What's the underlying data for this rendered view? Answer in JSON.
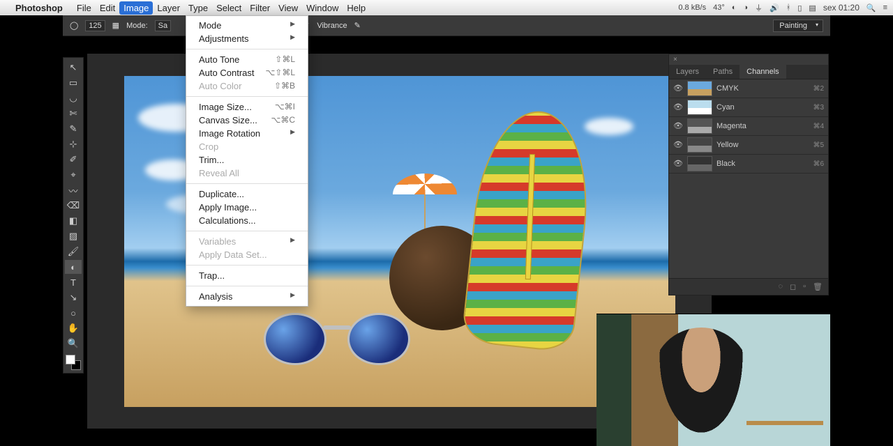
{
  "menubar": {
    "app": "Photoshop",
    "items": [
      "File",
      "Edit",
      "Image",
      "Layer",
      "Type",
      "Select",
      "Filter",
      "View",
      "Window",
      "Help"
    ],
    "active_index": 2,
    "status_net": "0.8 kB/s",
    "status_temp": "43°",
    "clock": "sex 01:20"
  },
  "options_bar": {
    "brush_size": "125",
    "mode_label": "Mode:",
    "mode_value": "Sa",
    "vibrance_label": "Vibrance",
    "workspace": "Painting"
  },
  "dropdown": {
    "groups": [
      [
        {
          "label": "Mode",
          "submenu": true
        },
        {
          "label": "Adjustments",
          "submenu": true
        }
      ],
      [
        {
          "label": "Auto Tone",
          "shortcut": "⇧⌘L"
        },
        {
          "label": "Auto Contrast",
          "shortcut": "⌥⇧⌘L"
        },
        {
          "label": "Auto Color",
          "shortcut": "⇧⌘B",
          "disabled": true
        }
      ],
      [
        {
          "label": "Image Size...",
          "shortcut": "⌥⌘I"
        },
        {
          "label": "Canvas Size...",
          "shortcut": "⌥⌘C"
        },
        {
          "label": "Image Rotation",
          "submenu": true
        },
        {
          "label": "Crop",
          "disabled": true
        },
        {
          "label": "Trim..."
        },
        {
          "label": "Reveal All",
          "disabled": true
        }
      ],
      [
        {
          "label": "Duplicate..."
        },
        {
          "label": "Apply Image..."
        },
        {
          "label": "Calculations..."
        }
      ],
      [
        {
          "label": "Variables",
          "submenu": true,
          "disabled": true
        },
        {
          "label": "Apply Data Set...",
          "disabled": true
        }
      ],
      [
        {
          "label": "Trap..."
        }
      ],
      [
        {
          "label": "Analysis",
          "submenu": true
        }
      ]
    ]
  },
  "tools": [
    "↖",
    "▭",
    "◡",
    "✄",
    "✎",
    "⊹",
    "✐",
    "⌖",
    "〰",
    "⌫",
    "◧",
    "▨",
    "🖌",
    "◐",
    "T",
    "↘",
    "○",
    "✋",
    "🔍"
  ],
  "channels_panel": {
    "tabs": [
      "Layers",
      "Paths",
      "Channels"
    ],
    "active_tab": 2,
    "rows": [
      {
        "name": "CMYK",
        "shortcut": "⌘2",
        "cls": "cmyk"
      },
      {
        "name": "Cyan",
        "shortcut": "⌘3",
        "cls": "c"
      },
      {
        "name": "Magenta",
        "shortcut": "⌘4",
        "cls": "m"
      },
      {
        "name": "Yellow",
        "shortcut": "⌘5",
        "cls": "y"
      },
      {
        "name": "Black",
        "shortcut": "⌘6",
        "cls": "k"
      }
    ]
  }
}
